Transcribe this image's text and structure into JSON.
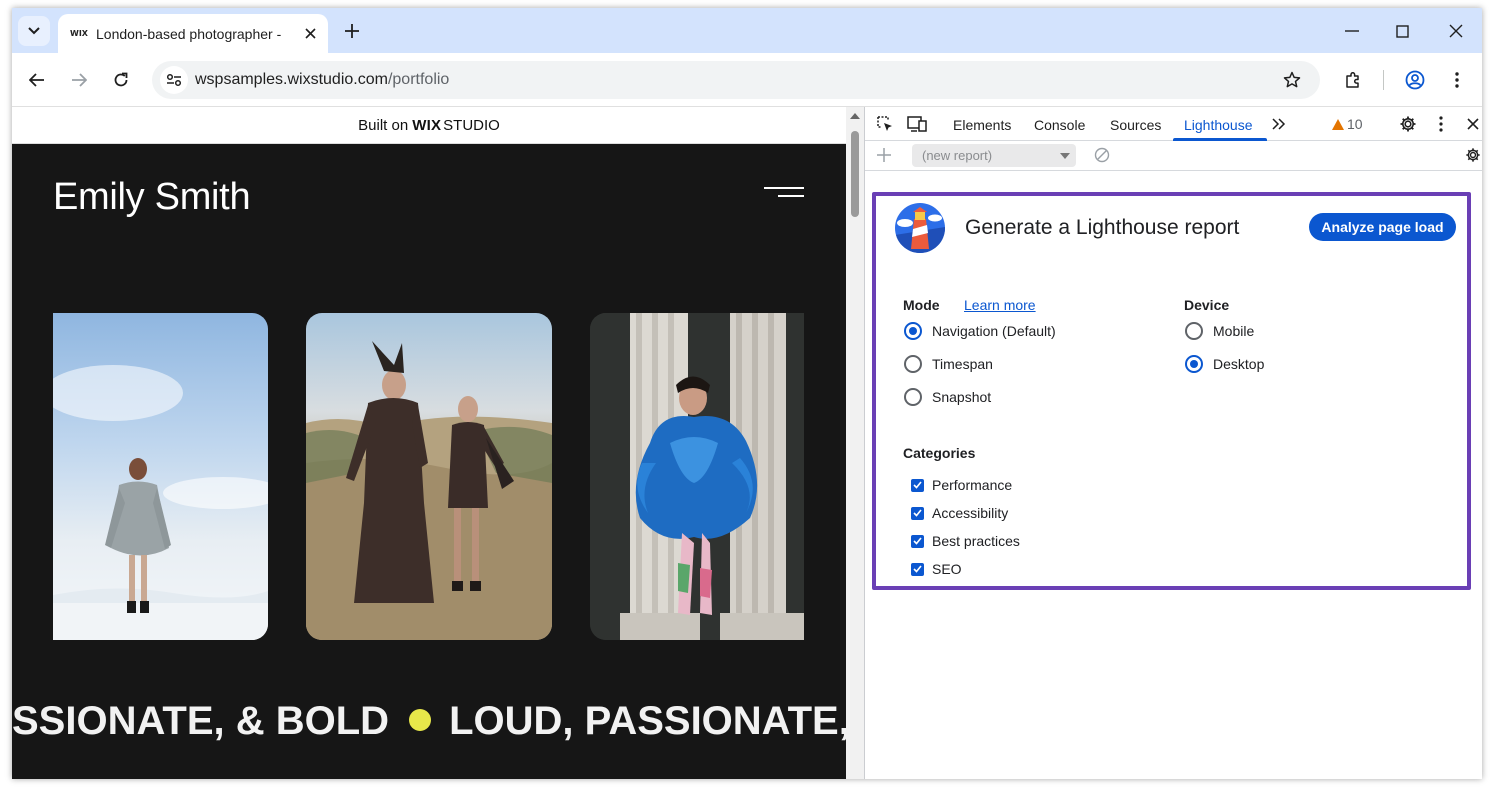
{
  "browser": {
    "tab_title": "London-based photographer -",
    "tab_favicon_text": "WIX",
    "url_domain": "wspsamples.wixstudio.com",
    "url_path": "/portfolio"
  },
  "page": {
    "built_on_text": "Built on",
    "built_on_brand": "WIX",
    "built_on_studio": "STUDIO",
    "site_name": "Emily Smith",
    "marquee_left": "SSIONATE, & BOLD",
    "marquee_right": "LOUD, PASSIONATE, & BO",
    "accent_color": "#e8e84a"
  },
  "devtools": {
    "tabs": [
      "Elements",
      "Console",
      "Sources",
      "Lighthouse"
    ],
    "active_tab": "Lighthouse",
    "warning_count": "10",
    "report_select": "(new report)"
  },
  "lighthouse": {
    "title": "Generate a Lighthouse report",
    "analyze_button": "Analyze page load",
    "mode_label": "Mode",
    "learn_more": "Learn more",
    "modes": [
      {
        "label": "Navigation (Default)",
        "selected": true
      },
      {
        "label": "Timespan",
        "selected": false
      },
      {
        "label": "Snapshot",
        "selected": false
      }
    ],
    "device_label": "Device",
    "devices": [
      {
        "label": "Mobile",
        "selected": false
      },
      {
        "label": "Desktop",
        "selected": true
      }
    ],
    "categories_label": "Categories",
    "categories": [
      {
        "label": "Performance",
        "checked": true
      },
      {
        "label": "Accessibility",
        "checked": true
      },
      {
        "label": "Best practices",
        "checked": true
      },
      {
        "label": "SEO",
        "checked": true
      }
    ],
    "highlight_color": "#6a3fb5"
  }
}
